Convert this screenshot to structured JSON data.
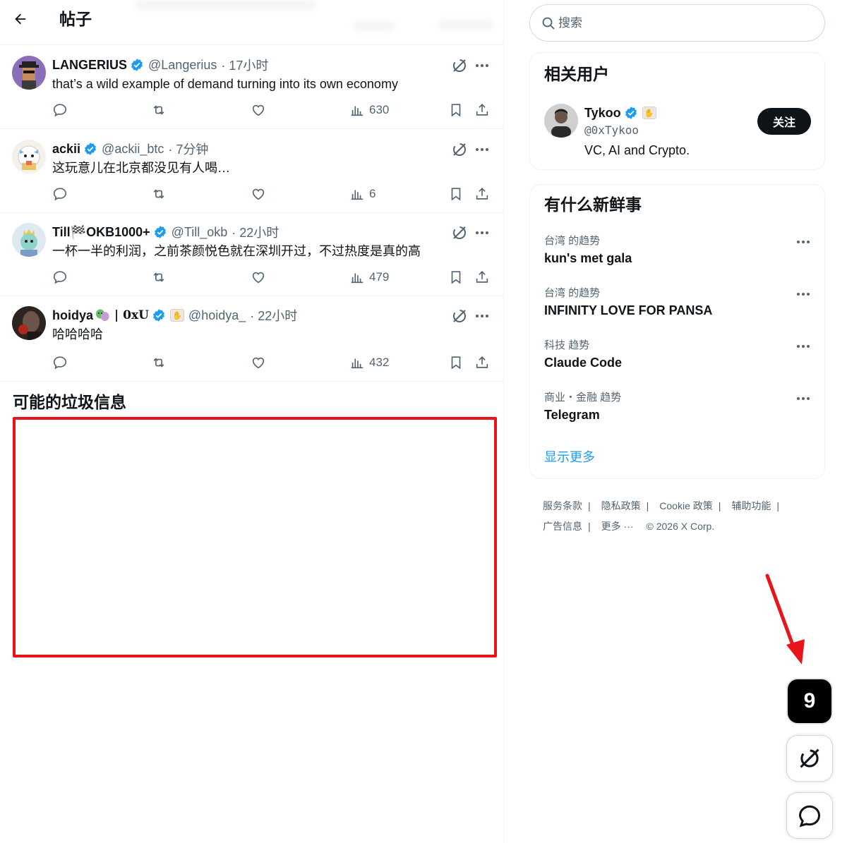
{
  "header": {
    "title": "帖子"
  },
  "posts": [
    {
      "name": "LANGERIUS",
      "handle": "@Langerius",
      "time": "· 17小时",
      "text": "that’s a wild example of demand turning into its own economy",
      "views": "630",
      "verified": true
    },
    {
      "name": "ackii",
      "handle": "@ackii_btc",
      "time": "· 7分钟",
      "text": "这玩意儿在北京都没见有人喝…",
      "views": "6",
      "verified": true
    },
    {
      "name": "Till🏁OKB1000+",
      "handle": "@Till_okb",
      "time": "· 22小时",
      "text": "一杯一半的利润，之前茶颜悦色就在深圳开过，不过热度是真的高",
      "views": "479",
      "verified": true
    },
    {
      "name": "hoidya",
      "name_suffix": "| 0xU",
      "handle": "@hoidya_",
      "time": "· 22小时",
      "text": "哈哈哈哈",
      "views": "432",
      "verified": true
    }
  ],
  "spam_section": {
    "title": "可能的垃圾信息"
  },
  "search": {
    "placeholder": "搜索"
  },
  "related_users": {
    "title": "相关用户",
    "user": {
      "name": "Tykoo",
      "handle": "@0xTykoo",
      "bio": "VC, AI and Crypto.",
      "follow_label": "关注"
    }
  },
  "trending": {
    "title": "有什么新鲜事",
    "items": [
      {
        "meta": "台湾 的趋势",
        "name": "kun's met gala"
      },
      {
        "meta": "台湾 的趋势",
        "name": "INFINITY LOVE FOR PANSA"
      },
      {
        "meta": "科技 趋势",
        "name": "Claude Code"
      },
      {
        "meta": "商业・金融 趋势",
        "name": "Telegram"
      }
    ],
    "show_more": "显示更多"
  },
  "footer": {
    "links": [
      "服务条款",
      "隐私政策",
      "Cookie 政策",
      "辅助功能",
      "广告信息",
      "更多 ···"
    ],
    "copyright": "© 2026 X Corp."
  },
  "floating": {
    "notification_count": "9"
  },
  "colors": {
    "accent": "#1d9bf0",
    "text": "#0f1419",
    "secondary": "#536471",
    "highlight_box": "#e8141b"
  }
}
